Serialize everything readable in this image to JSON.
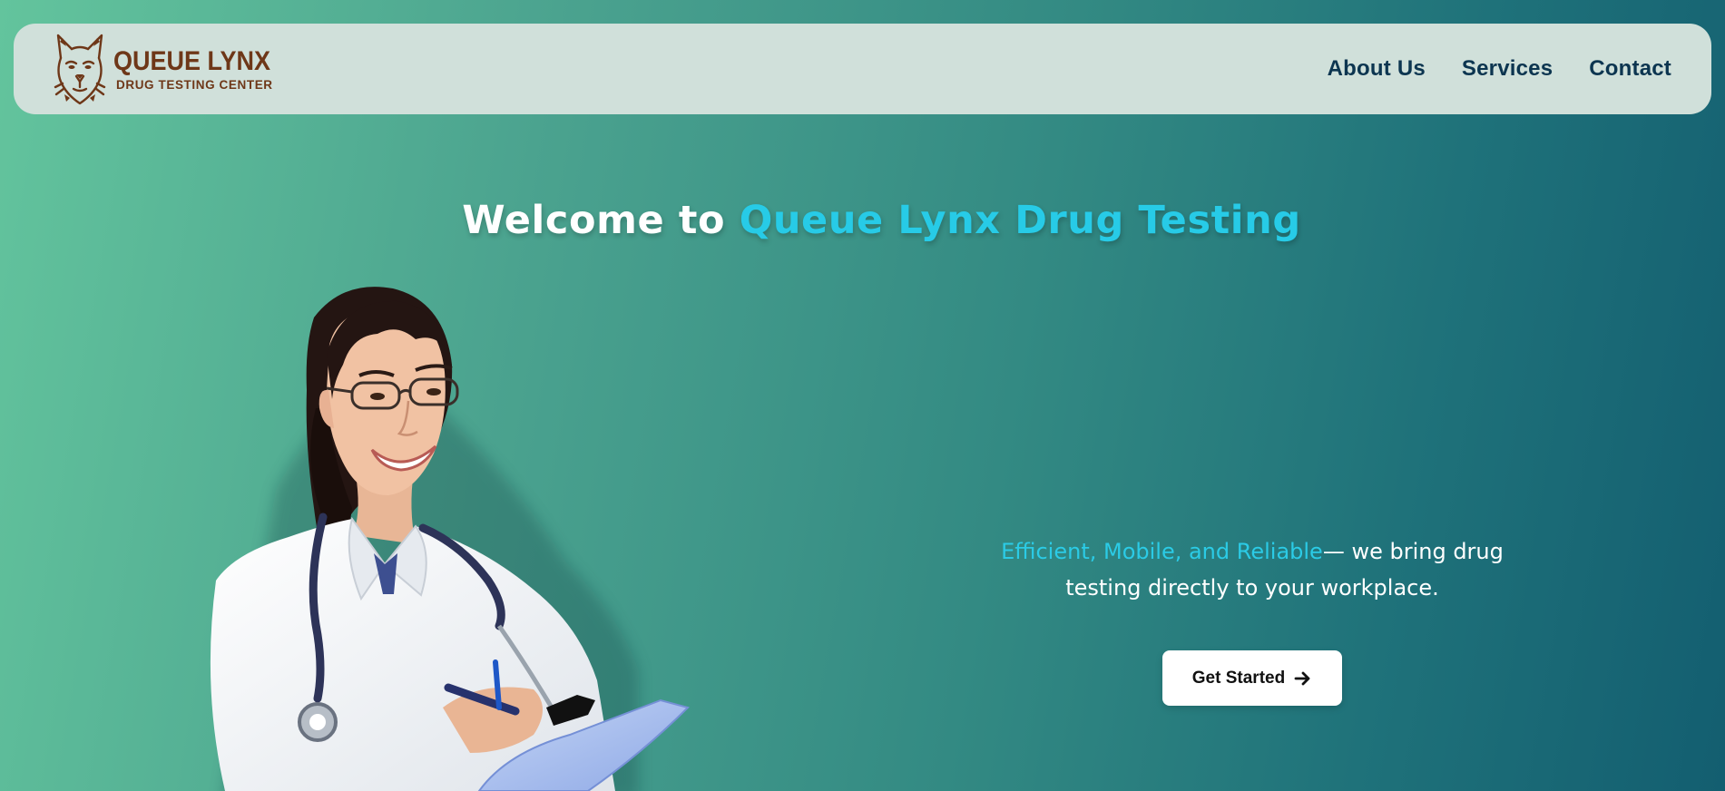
{
  "brand": {
    "name": "QUEUE LYNX",
    "subtitle": "DRUG TESTING CENTER",
    "color": "#6e3718"
  },
  "nav": {
    "links": [
      {
        "label": "About Us"
      },
      {
        "label": "Services"
      },
      {
        "label": "Contact"
      }
    ],
    "text_color": "#0c3550",
    "background": "#d0e0da"
  },
  "hero": {
    "title_prefix": "Welcome to ",
    "title_highlight": "Queue Lynx Drug Testing",
    "tagline_highlight": "Efficient, Mobile, and Reliable",
    "tagline_rest": "— we bring drug testing directly to your workplace.",
    "cta_label": "Get Started",
    "cta_icon": "arrow-right-icon",
    "accent_color": "#27cbe7",
    "image": "doctor-with-clipboard-illustration"
  },
  "theme": {
    "gradient_start": "#63c49d",
    "gradient_end": "#135e70"
  }
}
